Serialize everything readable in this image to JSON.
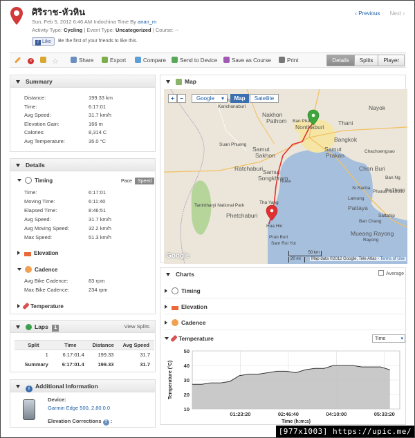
{
  "header": {
    "title": "ศิริราช-หัวหิน",
    "date_line": "Sun, Feb 5, 2012 6:46 AM Indochina Time By",
    "author": "anan_m",
    "activity_label": "Activity Type:",
    "activity_value": "Cycling",
    "event_label": "| Event Type:",
    "event_value": "Uncategorized",
    "course_label": "| Course:",
    "course_value": "--",
    "like_label": "Like",
    "like_text": "Be the first of your friends to like this.",
    "prev_label": "Previous",
    "next_label": "Next"
  },
  "toolbar": {
    "share": "Share",
    "export": "Export",
    "compare": "Compare",
    "send": "Send to Device",
    "save_course": "Save as Course",
    "print": "Print",
    "tabs": [
      "Details",
      "Splits",
      "Player"
    ]
  },
  "summary": {
    "title": "Summary",
    "rows": [
      {
        "label": "Distance:",
        "value": "199.33 km"
      },
      {
        "label": "Time:",
        "value": "6:17:01"
      },
      {
        "label": "Avg Speed:",
        "value": "31.7 km/h"
      },
      {
        "label": "Elevation Gain:",
        "value": "166 m"
      },
      {
        "label": "Calories:",
        "value": "8,314 C"
      },
      {
        "label": "Avg Temperature:",
        "value": "35.0 °C"
      }
    ]
  },
  "details": {
    "title": "Details",
    "timing": "Timing",
    "pace": "Pace",
    "speed": "Speed",
    "timing_rows": [
      {
        "label": "Time:",
        "value": "6:17:01"
      },
      {
        "label": "Moving Time:",
        "value": "6:11:40"
      },
      {
        "label": "Elapsed Time:",
        "value": "8:46:51"
      },
      {
        "label": "Avg Speed:",
        "value": "31.7 km/h"
      },
      {
        "label": "Avg Moving Speed:",
        "value": "32.2 km/h"
      },
      {
        "label": "Max Speed:",
        "value": "51.3 km/h"
      }
    ],
    "elevation": "Elevation",
    "cadence": "Cadence",
    "cadence_rows": [
      {
        "label": "Avg Bike Cadence:",
        "value": "83 rpm"
      },
      {
        "label": "Max Bike Cadence:",
        "value": "234 rpm"
      }
    ],
    "temperature": "Temperature"
  },
  "laps": {
    "title": "Laps",
    "count": "1",
    "view_splits": "View Splits",
    "columns": [
      "Split",
      "Time",
      "Distance",
      "Avg Speed"
    ],
    "rows": [
      [
        "1",
        "6:17:01.4",
        "199.33",
        "31.7"
      ],
      [
        "Summary",
        "6:17:01.4",
        "199.33",
        "31.7"
      ]
    ]
  },
  "additional": {
    "title": "Additional Information",
    "device_label": "Device:",
    "device_value": "Garmin Edge 500, 2.80.0.0",
    "elev_corr": "Elevation Corrections"
  },
  "map": {
    "title": "Map",
    "provider": "Google",
    "map_btn": "Map",
    "sat_btn": "Satellite",
    "places": [
      {
        "name": "Nakhon",
        "cls": "big"
      },
      {
        "name": "Pathom",
        "cls": "big"
      },
      {
        "name": "Nonthaburi",
        "cls": "big"
      },
      {
        "name": "Thani",
        "cls": "big"
      },
      {
        "name": "Nayok",
        "cls": "big"
      },
      {
        "name": "Mueang",
        "cls": ""
      },
      {
        "name": "Kanchanaburi",
        "cls": ""
      },
      {
        "name": "Ban Phaeo",
        "cls": ""
      },
      {
        "name": "Bangkok",
        "cls": "big"
      },
      {
        "name": "Suan Phueng",
        "cls": ""
      },
      {
        "name": "Samut",
        "cls": "big"
      },
      {
        "name": "Sakhon",
        "cls": "big"
      },
      {
        "name": "Samut",
        "cls": "big"
      },
      {
        "name": "Prakan",
        "cls": "big"
      },
      {
        "name": "Chachoengsao",
        "cls": ""
      },
      {
        "name": "Ratchaburi",
        "cls": "big"
      },
      {
        "name": "Samut",
        "cls": "big"
      },
      {
        "name": "Songkhram",
        "cls": "big"
      },
      {
        "name": "Chon Buri",
        "cls": "big"
      },
      {
        "name": "Si Racha",
        "cls": ""
      },
      {
        "name": "Phanat Nikhom",
        "cls": ""
      },
      {
        "name": "Tha Yang",
        "cls": ""
      },
      {
        "name": "Tanintharyi National Park",
        "cls": ""
      },
      {
        "name": "Phetchaburi",
        "cls": "big"
      },
      {
        "name": "Pattaya",
        "cls": "big"
      },
      {
        "name": "Sattahip",
        "cls": ""
      },
      {
        "name": "Ban Chang",
        "cls": ""
      },
      {
        "name": "Hua Hin",
        "cls": ""
      },
      {
        "name": "Pran Buri",
        "cls": ""
      },
      {
        "name": "Sam Roi Yot",
        "cls": ""
      },
      {
        "name": "Bo Thong",
        "cls": ""
      },
      {
        "name": "Lamung",
        "cls": ""
      },
      {
        "name": "Mueang Rayong",
        "cls": "big"
      },
      {
        "name": "Rayong",
        "cls": ""
      },
      {
        "name": "Nuea",
        "cls": ""
      },
      {
        "name": "Ban Ng",
        "cls": ""
      }
    ],
    "scale_km": "50 km",
    "scale_mi": "20 mi",
    "attribution": "Map data ©2012 Google, Tele Atlas -",
    "terms": "Terms of Use",
    "logo": "Google"
  },
  "charts": {
    "title": "Charts",
    "average_label": "Average",
    "timing": "Timing",
    "elevation": "Elevation",
    "cadence": "Cadence",
    "temperature": "Temperature",
    "xaxis_option": "Time"
  },
  "chart_data": {
    "type": "area",
    "x": [
      "0:00:00",
      "0:16:20",
      "0:32:40",
      "0:49:00",
      "1:05:20",
      "1:21:40",
      "1:38:00",
      "1:54:20",
      "2:10:40",
      "2:27:00",
      "2:43:20",
      "2:59:40",
      "3:16:00",
      "3:32:20",
      "3:48:40",
      "4:05:00",
      "4:21:20",
      "4:37:40",
      "4:54:00",
      "5:10:20",
      "5:26:40",
      "5:43:00"
    ],
    "values": [
      27,
      27,
      28,
      28,
      29,
      33,
      34,
      34,
      35,
      36,
      36,
      35,
      37,
      38,
      38,
      40,
      40,
      40,
      39,
      39,
      39,
      37
    ],
    "ylabel": "Temperature (°C)",
    "xlabel": "Time (h:m:s)",
    "ylim": [
      10,
      50
    ],
    "yticks": [
      10,
      20,
      30,
      40,
      50
    ],
    "xtick_labels": [
      "01:23:20",
      "02:46:40",
      "04:10:00",
      "05:33:20"
    ],
    "xtick_values": [
      1.3889,
      2.7778,
      4.1667,
      5.5556
    ],
    "xlim": [
      0,
      6.0
    ],
    "grid": true,
    "fill_color": "#c3c3c3",
    "line_color": "#333333"
  },
  "watermark": "[977x1003] https://upic.me/"
}
